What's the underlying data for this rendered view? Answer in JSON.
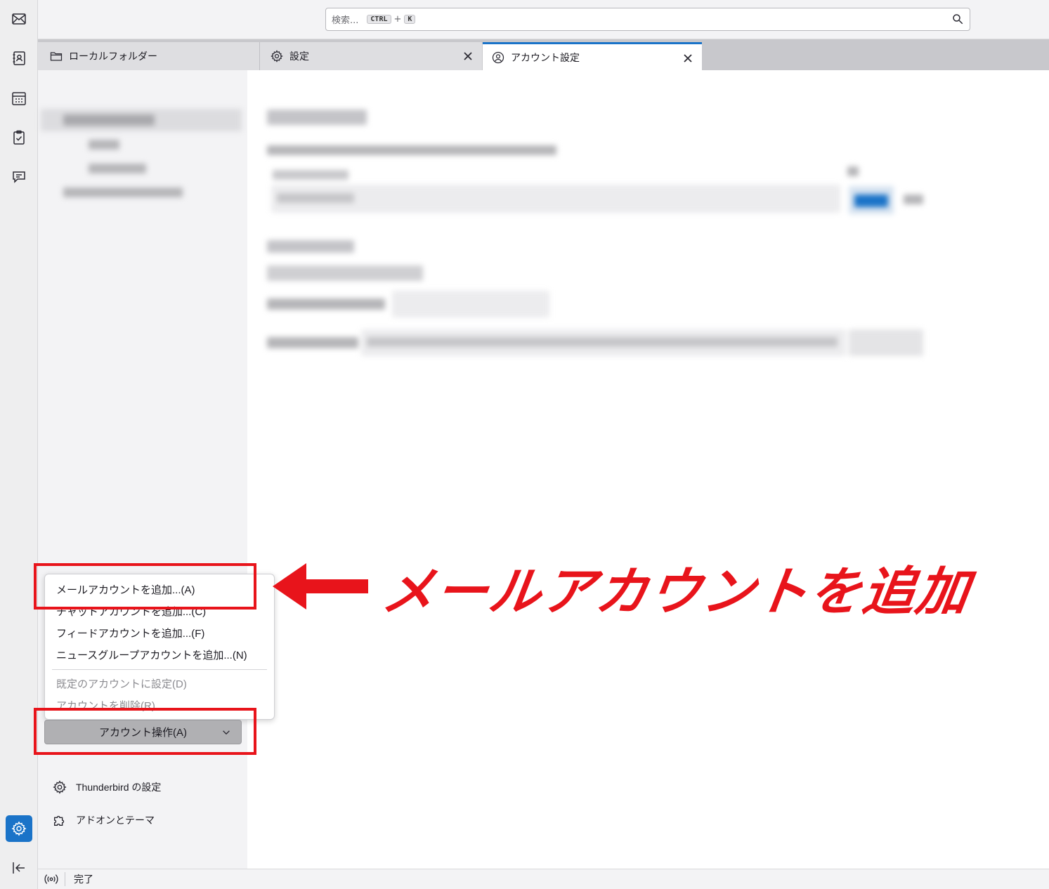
{
  "search": {
    "placeholder": "検索...",
    "key1": "CTRL",
    "plus": "+",
    "key2": "K"
  },
  "tabs": [
    {
      "label": "ローカルフォルダー"
    },
    {
      "label": "設定"
    },
    {
      "label": "アカウント設定"
    }
  ],
  "menu": {
    "items": [
      {
        "label": "メールアカウントを追加...(A)"
      },
      {
        "label": "チャットアカウントを追加...(C)"
      },
      {
        "label": "フィードアカウントを追加...(F)"
      },
      {
        "label": "ニュースグループアカウントを追加...(N)"
      },
      {
        "label": "既定のアカウントに設定(D)"
      },
      {
        "label": "アカウントを削除(R)"
      }
    ]
  },
  "account_actions": {
    "label": "アカウント操作(A)"
  },
  "footer_links": {
    "settings": "Thunderbird の設定",
    "addons": "アドオンとテーマ"
  },
  "status": {
    "text": "完了"
  },
  "annotation": {
    "text": "メールアカウントを追加",
    "color": "#e8141b"
  },
  "colors": {
    "accent": "#1a73c8"
  }
}
